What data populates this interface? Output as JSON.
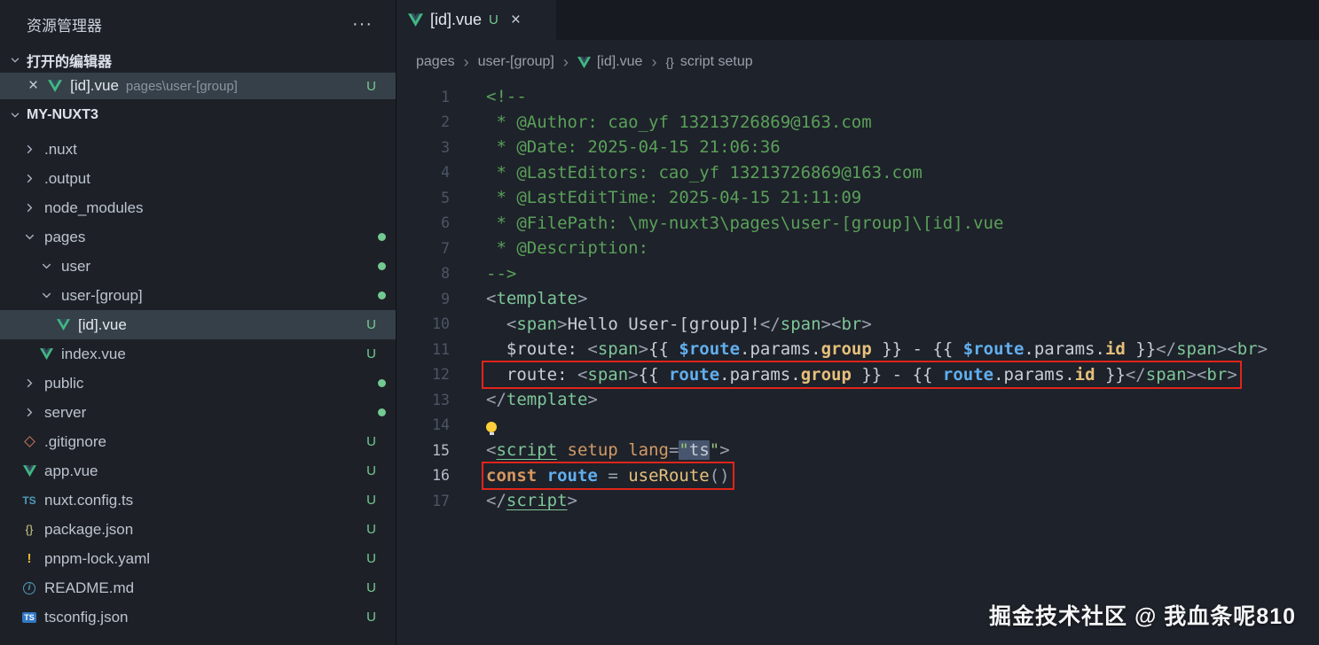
{
  "icons": {
    "close": "×",
    "more": "···",
    "separator": "›"
  },
  "colors": {
    "git_untracked_green": "#73c991",
    "vue_green": "#41b883",
    "annotation_red": "#e1251b",
    "accent_blue": "#61afef"
  },
  "sidebar": {
    "title": "资源管理器",
    "open_editors_section": {
      "label": "打开的编辑器",
      "items": [
        {
          "icon": "vue-icon",
          "name": "[id].vue",
          "path": "pages\\user-[group]",
          "badge": "U",
          "selected": true
        }
      ]
    },
    "project_section": {
      "label": "MY-NUXT3",
      "tree": [
        {
          "label": ".nuxt",
          "kind": "folder",
          "level": 1,
          "expanded": false
        },
        {
          "label": ".output",
          "kind": "folder",
          "level": 1,
          "expanded": false
        },
        {
          "label": "node_modules",
          "kind": "folder",
          "level": 1,
          "expanded": false
        },
        {
          "label": "pages",
          "kind": "folder",
          "level": 1,
          "expanded": true,
          "dot": true
        },
        {
          "label": "user",
          "kind": "folder",
          "level": 2,
          "expanded": true,
          "dot": true
        },
        {
          "label": "user-[group]",
          "kind": "folder",
          "level": 2,
          "expanded": true,
          "dot": true
        },
        {
          "label": "[id].vue",
          "kind": "file",
          "icon": "vue-icon",
          "level": 3,
          "badge": "U",
          "selected": true
        },
        {
          "label": "index.vue",
          "kind": "file",
          "icon": "vue-icon",
          "level": 2,
          "badge": "U"
        },
        {
          "label": "public",
          "kind": "folder",
          "level": 1,
          "expanded": false,
          "dot": true
        },
        {
          "label": "server",
          "kind": "folder",
          "level": 1,
          "expanded": false,
          "dot": true
        },
        {
          "label": ".gitignore",
          "kind": "file",
          "icon": "git-icon",
          "level": 1,
          "badge": "U"
        },
        {
          "label": "app.vue",
          "kind": "file",
          "icon": "vue-icon",
          "level": 1,
          "badge": "U"
        },
        {
          "label": "nuxt.config.ts",
          "kind": "file",
          "icon": "ts-icon",
          "level": 1,
          "badge": "U"
        },
        {
          "label": "package.json",
          "kind": "file",
          "icon": "braces-icon",
          "level": 1,
          "badge": "U"
        },
        {
          "label": "pnpm-lock.yaml",
          "kind": "file",
          "icon": "exclamation-icon",
          "level": 1,
          "badge": "U"
        },
        {
          "label": "README.md",
          "kind": "file",
          "icon": "info-icon",
          "level": 1,
          "badge": "U"
        },
        {
          "label": "tsconfig.json",
          "kind": "file",
          "icon": "tsconfig-icon",
          "level": 1,
          "badge": "U"
        }
      ]
    }
  },
  "editor": {
    "tab": {
      "icon": "vue-icon",
      "name": "[id].vue",
      "badge": "U"
    },
    "breadcrumb": [
      {
        "label": "pages"
      },
      {
        "label": "user-[group]"
      },
      {
        "label": "[id].vue",
        "icon": "vue-icon"
      },
      {
        "label": "script setup",
        "icon": "braces-icon"
      }
    ],
    "code": {
      "lines": [
        {
          "num": 1,
          "tokens": [
            [
              "<!--",
              "comment"
            ]
          ]
        },
        {
          "num": 2,
          "tokens": [
            [
              " * @Author: cao_yf 13213726869@163.com",
              "comment"
            ]
          ]
        },
        {
          "num": 3,
          "tokens": [
            [
              " * @Date: 2025-04-15 21:06:36",
              "comment"
            ]
          ]
        },
        {
          "num": 4,
          "tokens": [
            [
              " * @LastEditors: cao_yf 13213726869@163.com",
              "comment"
            ]
          ]
        },
        {
          "num": 5,
          "tokens": [
            [
              " * @LastEditTime: 2025-04-15 21:11:09",
              "comment"
            ]
          ]
        },
        {
          "num": 6,
          "tokens": [
            [
              " * @FilePath: \\my-nuxt3\\pages\\user-[group]\\[id].vue",
              "comment"
            ]
          ]
        },
        {
          "num": 7,
          "tokens": [
            [
              " * @Description: ",
              "comment"
            ]
          ]
        },
        {
          "num": 8,
          "tokens": [
            [
              "-->",
              "comment"
            ]
          ]
        },
        {
          "num": 9,
          "tokens": [
            [
              "<",
              "punct"
            ],
            [
              "template",
              "tag"
            ],
            [
              ">",
              "punct"
            ]
          ]
        },
        {
          "num": 10,
          "tokens": [
            [
              "  ",
              "plain"
            ],
            [
              "<",
              "punct"
            ],
            [
              "span",
              "tag"
            ],
            [
              ">",
              "punct"
            ],
            [
              "Hello User-[group]!",
              "plain"
            ],
            [
              "</",
              "punct"
            ],
            [
              "span",
              "tag"
            ],
            [
              ">",
              "punct"
            ],
            [
              "<",
              "punct"
            ],
            [
              "br",
              "tag"
            ],
            [
              ">",
              "punct"
            ]
          ]
        },
        {
          "num": 11,
          "tokens": [
            [
              "  $route: ",
              "plain"
            ],
            [
              "<",
              "punct"
            ],
            [
              "span",
              "tag"
            ],
            [
              ">",
              "punct"
            ],
            [
              "{{ ",
              "plain"
            ],
            [
              "$route",
              "var"
            ],
            [
              ".",
              "plain"
            ],
            [
              "params",
              "plain"
            ],
            [
              ".",
              "plain"
            ],
            [
              "group",
              "prop"
            ],
            [
              " }}",
              "plain"
            ],
            [
              " - ",
              "plain"
            ],
            [
              "{{ ",
              "plain"
            ],
            [
              "$route",
              "var"
            ],
            [
              ".",
              "plain"
            ],
            [
              "params",
              "plain"
            ],
            [
              ".",
              "plain"
            ],
            [
              "id",
              "prop"
            ],
            [
              " }}",
              "plain"
            ],
            [
              "</",
              "punct"
            ],
            [
              "span",
              "tag"
            ],
            [
              ">",
              "punct"
            ],
            [
              "<",
              "punct"
            ],
            [
              "br",
              "tag"
            ],
            [
              ">",
              "punct"
            ]
          ]
        },
        {
          "num": 12,
          "boxed": true,
          "tokens": [
            [
              "  route: ",
              "plain"
            ],
            [
              "<",
              "punct"
            ],
            [
              "span",
              "tag"
            ],
            [
              ">",
              "punct"
            ],
            [
              "{{ ",
              "plain"
            ],
            [
              "route",
              "var"
            ],
            [
              ".",
              "plain"
            ],
            [
              "params",
              "plain"
            ],
            [
              ".",
              "plain"
            ],
            [
              "group",
              "prop"
            ],
            [
              " }}",
              "plain"
            ],
            [
              " - ",
              "plain"
            ],
            [
              "{{ ",
              "plain"
            ],
            [
              "route",
              "var"
            ],
            [
              ".",
              "plain"
            ],
            [
              "params",
              "plain"
            ],
            [
              ".",
              "plain"
            ],
            [
              "id",
              "prop"
            ],
            [
              " }}",
              "plain"
            ],
            [
              "</",
              "punct"
            ],
            [
              "span",
              "tag"
            ],
            [
              ">",
              "punct"
            ],
            [
              "<",
              "punct"
            ],
            [
              "br",
              "tag"
            ],
            [
              ">",
              "punct"
            ]
          ]
        },
        {
          "num": 13,
          "tokens": [
            [
              "</",
              "punct"
            ],
            [
              "template",
              "tag"
            ],
            [
              ">",
              "punct"
            ]
          ]
        },
        {
          "num": 14,
          "bulb": true,
          "tokens": []
        },
        {
          "num": 15,
          "bright": true,
          "tokens": [
            [
              "<",
              "punct"
            ],
            [
              "script",
              "tag u"
            ],
            [
              " ",
              "plain"
            ],
            [
              "setup",
              "attr"
            ],
            [
              " ",
              "plain"
            ],
            [
              "lang",
              "attr"
            ],
            [
              "=",
              "punct"
            ],
            [
              "\"",
              "str sel"
            ],
            [
              "ts",
              "plain sel"
            ],
            [
              "\"",
              "str"
            ],
            [
              ">",
              "punct"
            ]
          ]
        },
        {
          "num": 16,
          "bright": true,
          "boxed": true,
          "tokens": [
            [
              "const",
              "kw"
            ],
            [
              " ",
              "plain"
            ],
            [
              "route",
              "var"
            ],
            [
              " ",
              "plain"
            ],
            [
              "=",
              "punct"
            ],
            [
              " ",
              "plain"
            ],
            [
              "useRoute",
              "fn"
            ],
            [
              "()",
              "punct"
            ]
          ]
        },
        {
          "num": 17,
          "tokens": [
            [
              "</",
              "punct"
            ],
            [
              "script",
              "tag u"
            ],
            [
              ">",
              "punct"
            ]
          ]
        }
      ]
    }
  },
  "watermark": "掘金技术社区 @ 我血条呢810"
}
